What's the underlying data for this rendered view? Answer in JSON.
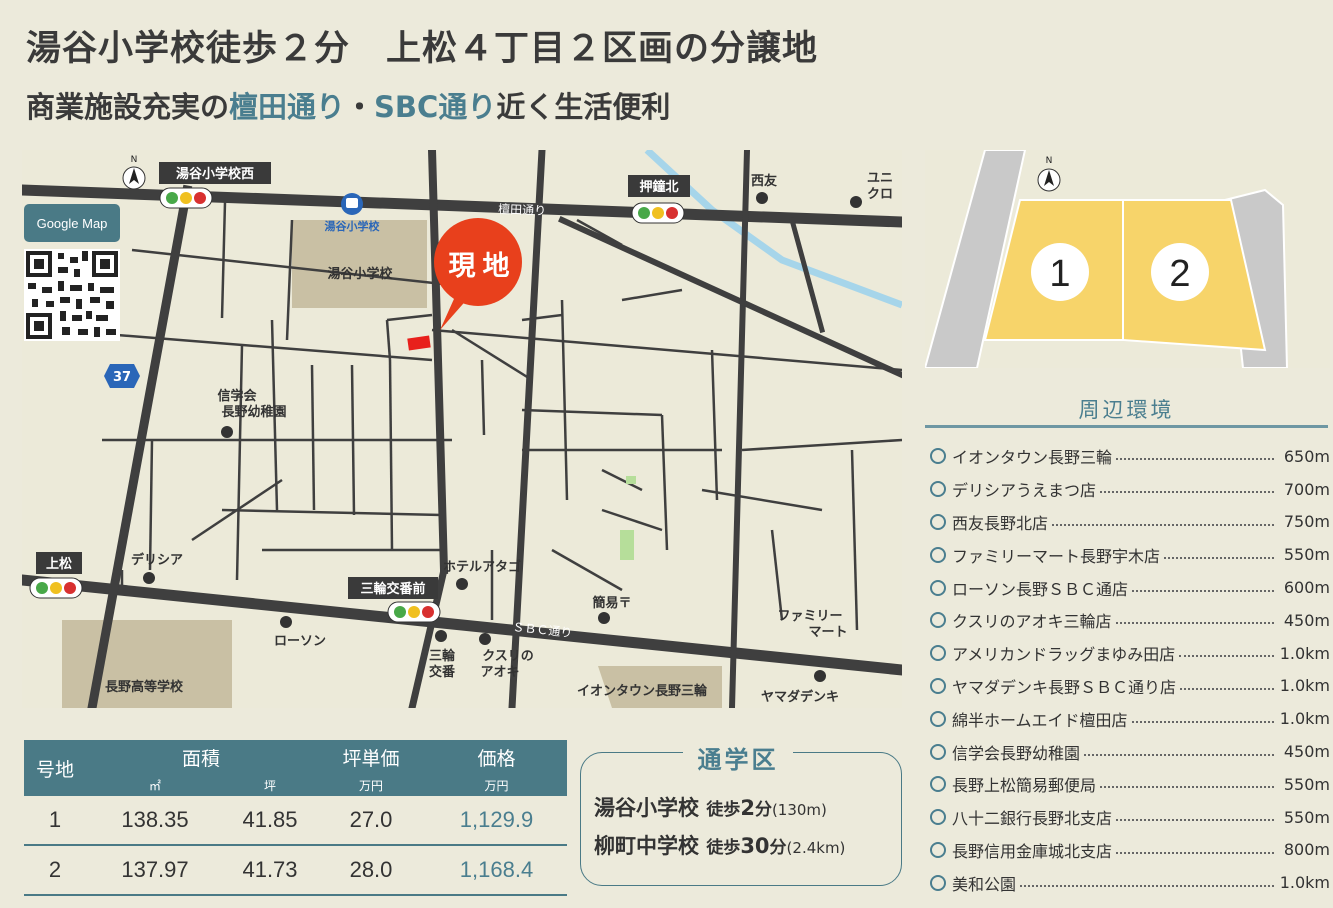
{
  "title": {
    "line1": "湯谷小学校徒歩２分　上松４丁目２区画の分譲地",
    "line2_a": "商業施設充実の",
    "line2_b": "檀田通り",
    "line2_c": "・",
    "line2_d": "SBC通り",
    "line2_e": "近く生活便利"
  },
  "colors": {
    "accent": "#4a7e8f",
    "header_bg": "#4a7a86",
    "site": "#e8401c",
    "lot": "#f7d46a",
    "background": "#eceadb"
  },
  "google_map": {
    "label": "Google Map"
  },
  "map": {
    "north": "N",
    "labels": {
      "signal_yuya_west": "湯谷小学校西",
      "signal_oshikane_kita": "押鐘北",
      "signal_uematsu": "上松",
      "signal_miwa_koban": "三輪交番前",
      "bus_stop": "湯谷小学校",
      "dangeta_street": "檀田通り",
      "sbc_street": "ＳＢＣ通り",
      "yuya_school": "湯谷小学校",
      "nishiyu": "西友",
      "uniqlo_1": "ユニ",
      "uniqlo_2": "クロ",
      "site_1": "現",
      "site_2": "地",
      "route": "37",
      "kindergarten_1": "信学会",
      "kindergarten_2": "長野幼稚園",
      "delicia": "デリシア",
      "hotel_atago": "ホテルアタゴ",
      "post_office": "簡易〒",
      "familymart_1": "ファミリー",
      "familymart_2": "マート",
      "lawson": "ローソン",
      "koban_1": "三輪",
      "koban_2": "交番",
      "kusuri_1": "クスリの",
      "kusuri_2": "アオキ",
      "aeon": "イオンタウン長野三輪",
      "yamada": "ヤマダデンキ",
      "nagano_high": "長野高等学校"
    }
  },
  "plot": {
    "north": "N",
    "lot1": "1",
    "lot2": "2"
  },
  "surroundings": {
    "title": "周辺環境",
    "items": [
      {
        "name": "イオンタウン長野三輪",
        "distance": "650m"
      },
      {
        "name": "デリシアうえまつ店",
        "distance": "700m"
      },
      {
        "name": "西友長野北店",
        "distance": "750m"
      },
      {
        "name": "ファミリーマート長野宇木店",
        "distance": "550m"
      },
      {
        "name": "ローソン長野ＳＢＣ通店",
        "distance": "600m"
      },
      {
        "name": "クスリのアオキ三輪店",
        "distance": "450m"
      },
      {
        "name": "アメリカンドラッグまゆみ田店",
        "distance": "1.0km"
      },
      {
        "name": "ヤマダデンキ長野ＳＢＣ通り店",
        "distance": "1.0km"
      },
      {
        "name": "綿半ホームエイド檀田店",
        "distance": "1.0km"
      },
      {
        "name": "信学会長野幼稚園",
        "distance": "450m"
      },
      {
        "name": "長野上松簡易郵便局",
        "distance": "550m"
      },
      {
        "name": "八十二銀行長野北支店",
        "distance": "550m"
      },
      {
        "name": "長野信用金庫城北支店",
        "distance": "800m"
      },
      {
        "name": "美和公園",
        "distance": "1.0km"
      }
    ]
  },
  "table": {
    "headers": {
      "lot": "号地",
      "area": "面積",
      "tsubo_price": "坪単価",
      "price": "価格"
    },
    "units": {
      "sqm": "㎡",
      "tsubo": "坪",
      "man_yen_1": "万円",
      "man_yen_2": "万円"
    },
    "rows": [
      {
        "lot": "1",
        "sqm": "138.35",
        "tsubo": "41.85",
        "unit_price": "27.0",
        "price": "1,129.9"
      },
      {
        "lot": "2",
        "sqm": "137.97",
        "tsubo": "41.73",
        "unit_price": "28.0",
        "price": "1,168.4"
      }
    ]
  },
  "school": {
    "title": "通学区",
    "rows": [
      {
        "school": "湯谷小学校",
        "walk": "徒歩",
        "minutes": "2",
        "unit": "分",
        "dist": "(130m)"
      },
      {
        "school": "柳町中学校",
        "walk": "徒歩",
        "minutes": "30",
        "unit": "分",
        "dist": "(2.4km)"
      }
    ]
  }
}
